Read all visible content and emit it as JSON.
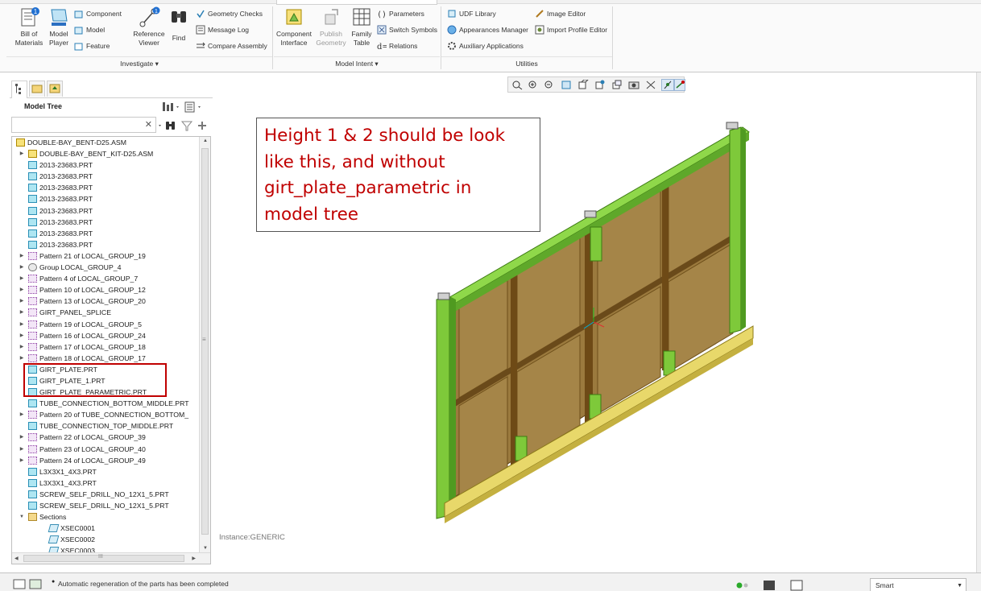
{
  "ribbon": {
    "investigate": {
      "bill_of_materials": "Bill of\nMaterials",
      "model_player": "Model\nPlayer",
      "component": "Component",
      "model": "Model",
      "feature": "Feature",
      "reference_viewer": "Reference\nViewer",
      "find": "Find",
      "geometry_checks": "Geometry Checks",
      "message_log": "Message Log",
      "compare_assembly": "Compare Assembly",
      "group_label": "Investigate ▾"
    },
    "model_intent": {
      "component_interface": "Component\nInterface",
      "publish_geometry": "Publish\nGeometry",
      "family_table": "Family\nTable",
      "parameters": "Parameters",
      "switch_symbols": "Switch Symbols",
      "relations": "Relations",
      "group_label": "Model Intent ▾"
    },
    "utilities": {
      "udf_library": "UDF Library",
      "appearances_manager": "Appearances Manager",
      "auxiliary_applications": "Auxiliary Applications",
      "image_editor": "Image Editor",
      "import_profile_editor": "Import Profile Editor",
      "group_label": "Utilities"
    },
    "badge": "1"
  },
  "model_tree": {
    "title": "Model Tree",
    "search_clear": "✕",
    "items": [
      {
        "label": "DOUBLE-BAY_BENT-D25.ASM",
        "icon": "asm",
        "level": 0,
        "arrow": ""
      },
      {
        "label": "DOUBLE-BAY_BENT_KIT-D25.ASM",
        "icon": "asm",
        "level": 1,
        "arrow": "▶"
      },
      {
        "label": "2013-23683.PRT",
        "icon": "part",
        "level": 1,
        "arrow": ""
      },
      {
        "label": "2013-23683.PRT",
        "icon": "part",
        "level": 1,
        "arrow": ""
      },
      {
        "label": "2013-23683.PRT",
        "icon": "part",
        "level": 1,
        "arrow": ""
      },
      {
        "label": "2013-23683.PRT",
        "icon": "part",
        "level": 1,
        "arrow": ""
      },
      {
        "label": "2013-23683.PRT",
        "icon": "part",
        "level": 1,
        "arrow": ""
      },
      {
        "label": "2013-23683.PRT",
        "icon": "part",
        "level": 1,
        "arrow": ""
      },
      {
        "label": "2013-23683.PRT",
        "icon": "part",
        "level": 1,
        "arrow": ""
      },
      {
        "label": "2013-23683.PRT",
        "icon": "part",
        "level": 1,
        "arrow": ""
      },
      {
        "label": "Pattern 21 of LOCAL_GROUP_19",
        "icon": "pattern",
        "level": 1,
        "arrow": "▶"
      },
      {
        "label": "Group LOCAL_GROUP_4",
        "icon": "group",
        "level": 1,
        "arrow": "▶"
      },
      {
        "label": "Pattern 4 of LOCAL_GROUP_7",
        "icon": "pattern",
        "level": 1,
        "arrow": "▶"
      },
      {
        "label": "Pattern 10 of LOCAL_GROUP_12",
        "icon": "pattern",
        "level": 1,
        "arrow": "▶"
      },
      {
        "label": "Pattern 13 of LOCAL_GROUP_20",
        "icon": "pattern",
        "level": 1,
        "arrow": "▶"
      },
      {
        "label": "GIRT_PANEL_SPLICE",
        "icon": "pattern",
        "level": 1,
        "arrow": "▶"
      },
      {
        "label": "Pattern 19 of LOCAL_GROUP_5",
        "icon": "pattern",
        "level": 1,
        "arrow": "▶"
      },
      {
        "label": "Pattern 16 of LOCAL_GROUP_24",
        "icon": "pattern",
        "level": 1,
        "arrow": "▶"
      },
      {
        "label": "Pattern 17 of LOCAL_GROUP_18",
        "icon": "pattern",
        "level": 1,
        "arrow": "▶"
      },
      {
        "label": "Pattern 18 of LOCAL_GROUP_17",
        "icon": "pattern",
        "level": 1,
        "arrow": "▶"
      },
      {
        "label": "GIRT_PLATE.PRT",
        "icon": "part",
        "level": 1,
        "arrow": ""
      },
      {
        "label": "GIRT_PLATE_1.PRT",
        "icon": "part",
        "level": 1,
        "arrow": ""
      },
      {
        "label": "GIRT_PLATE_PARAMETRIC.PRT",
        "icon": "part",
        "level": 1,
        "arrow": ""
      },
      {
        "label": "TUBE_CONNECTION_BOTTOM_MIDDLE.PRT",
        "icon": "part",
        "level": 1,
        "arrow": ""
      },
      {
        "label": "Pattern 20 of TUBE_CONNECTION_BOTTOM_",
        "icon": "pattern",
        "level": 1,
        "arrow": "▶"
      },
      {
        "label": "TUBE_CONNECTION_TOP_MIDDLE.PRT",
        "icon": "part",
        "level": 1,
        "arrow": ""
      },
      {
        "label": "Pattern 22 of LOCAL_GROUP_39",
        "icon": "pattern",
        "level": 1,
        "arrow": "▶"
      },
      {
        "label": "Pattern 23 of LOCAL_GROUP_40",
        "icon": "pattern",
        "level": 1,
        "arrow": "▶"
      },
      {
        "label": "Pattern 24 of LOCAL_GROUP_49",
        "icon": "pattern",
        "level": 1,
        "arrow": "▶"
      },
      {
        "label": "L3X3X1_4X3.PRT",
        "icon": "part",
        "level": 1,
        "arrow": ""
      },
      {
        "label": "L3X3X1_4X3.PRT",
        "icon": "part",
        "level": 1,
        "arrow": ""
      },
      {
        "label": "SCREW_SELF_DRILL_NO_12X1_5.PRT",
        "icon": "part",
        "level": 1,
        "arrow": ""
      },
      {
        "label": "SCREW_SELF_DRILL_NO_12X1_5.PRT",
        "icon": "part",
        "level": 1,
        "arrow": ""
      },
      {
        "label": "Sections",
        "icon": "folder",
        "level": 1,
        "arrow": "▼"
      },
      {
        "label": "XSEC0001",
        "icon": "xsec",
        "level": 2,
        "arrow": ""
      },
      {
        "label": "XSEC0002",
        "icon": "xsec",
        "level": 2,
        "arrow": ""
      },
      {
        "label": "XSEC0003",
        "icon": "xsec",
        "level": 2,
        "arrow": ""
      }
    ],
    "hscroll_grip": "III",
    "vscroll_grip": "≡"
  },
  "graphics": {
    "note": "Height 1 & 2 should be look\nlike this, and without\ngirt_plate_parametric in\nmodel tree",
    "instance": "Instance:GENERIC",
    "colors": {
      "note_red": "#c00000",
      "frame_green": "#7ec93a",
      "panel_brown": "#9c7a3c",
      "rail_yellow": "#e8d86a"
    }
  },
  "status": {
    "message": "Automatic regeneration of the parts has been completed",
    "filter": "Smart"
  }
}
